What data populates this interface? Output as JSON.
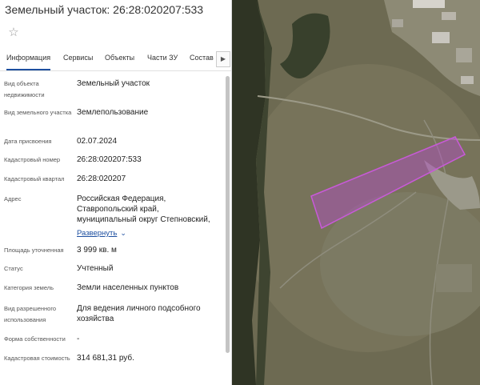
{
  "panel": {
    "title": "Земельный участок: 26:28:020207:533",
    "favorite_icon": "star-icon",
    "tabs": [
      "Информация",
      "Сервисы",
      "Объекты",
      "Части ЗУ",
      "Состав"
    ],
    "tabs_more_icon": "chevron-right-icon",
    "fields": [
      {
        "label": "Вид объекта недвижимости",
        "value": "Земельный участок"
      },
      {
        "label": "Вид земельного участка",
        "value": "Землепользование"
      },
      {
        "label": "Дата присвоения",
        "value": "02.07.2024"
      },
      {
        "label": "Кадастровый номер",
        "value": "26:28:020207:533"
      },
      {
        "label": "Кадастровый квартал",
        "value": "26:28:020207"
      },
      {
        "label": "Адрес",
        "value": "Российская Федерация, Ставропольский край, муниципальный округ Степновский,"
      },
      {
        "label": "Площадь уточненная",
        "value": "3 999 кв. м"
      },
      {
        "label": "Статус",
        "value": "Учтенный"
      },
      {
        "label": "Категория земель",
        "value": "Земли населенных пунктов"
      },
      {
        "label": "Вид разрешенного использования",
        "value": "Для ведения личного подсобного хозяйства"
      },
      {
        "label": "Форма собственности",
        "value": "-"
      },
      {
        "label": "Кадастровая стоимость",
        "value": "314 681,31 руб."
      }
    ],
    "expand_label": "Развернуть"
  },
  "map": {
    "parcel_color": "#b44bc8",
    "base": "satellite imagery"
  }
}
